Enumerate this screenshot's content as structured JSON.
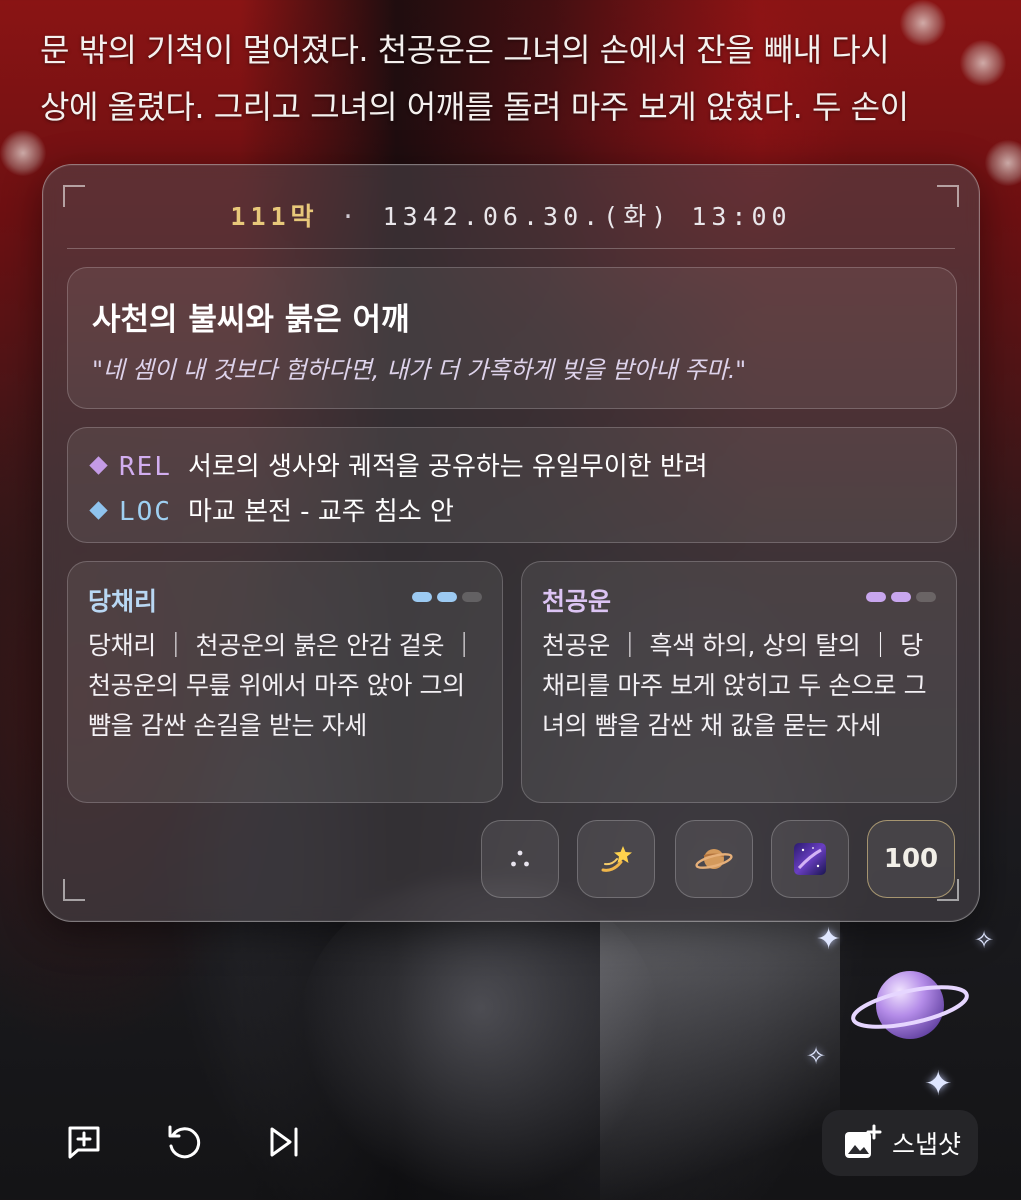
{
  "story": {
    "lines": [
      "문 밖의 기척이 멀어졌다. 천공운은 그녀의 손에서 잔을 빼내 다시",
      "상에 올렸다. 그리고 그녀의 어깨를 돌려 마주 보게 앉혔다. 두 손이"
    ]
  },
  "card": {
    "act": "111막",
    "separator": "·",
    "datetime": "1342.06.30.(화) 13:00",
    "scene_title": "사천의 불씨와 붉은 어깨",
    "scene_quote": "\"네 셈이 내 것보다 험하다면, 내가 더 가혹하게 빚을 받아내 주마.\"",
    "rel_key": "REL",
    "rel_value": "서로의 생사와 궤적을 공유하는 유일무이한 반려",
    "loc_key": "LOC",
    "loc_value": "마교 본전 - 교주 침소 안",
    "colors": {
      "rel": "#c49be6",
      "loc": "#8fc3ee",
      "act": "#e8c87a"
    }
  },
  "characters": [
    {
      "name": "당채리",
      "level": 2,
      "max_level": 3,
      "desc": "당채리 ｜ 천공운의 붉은 안감 겉옷 ｜ 천공운의 무릎 위에서 마주 앉아 그의 뺨을 감싼 손길을 받는 자세",
      "color": "#9ccaf2"
    },
    {
      "name": "천공운",
      "level": 2,
      "max_level": 3,
      "desc": "천공운 ｜ 흑색 하의, 상의 탈의 ｜ 당채리를 마주 보게 앉히고 두 손으로 그녀의 뺨을 감싼 채 값을 묻는 자세",
      "color": "#c8a6ee"
    }
  ],
  "actions": {
    "icons": [
      "dots-icon",
      "shooting-star-icon",
      "planet-icon",
      "galaxy-icon"
    ],
    "counter": "100"
  },
  "toolbar": {
    "icons": [
      "add-comment-icon",
      "refresh-icon",
      "skip-next-icon"
    ],
    "snapshot_label": "스냅샷"
  }
}
